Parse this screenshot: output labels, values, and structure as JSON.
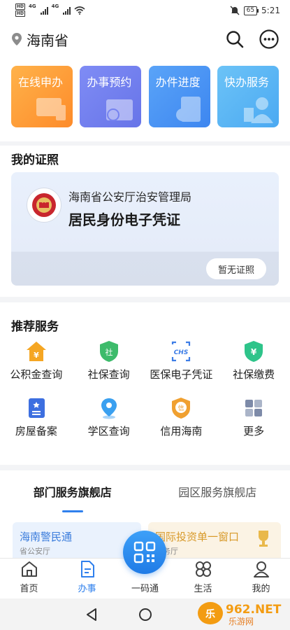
{
  "status_bar": {
    "sim1": "HD",
    "sim2": "HD",
    "net1": "4G",
    "net2": "4G",
    "battery": "65",
    "time": "5:21"
  },
  "header": {
    "province": "海南省"
  },
  "quick_tiles": [
    {
      "label": "在线申办"
    },
    {
      "label": "办事预约"
    },
    {
      "label": "办件进度"
    },
    {
      "label": "快办服务"
    }
  ],
  "licenses": {
    "title": "我的证照",
    "issuer": "海南省公安厅治安管理局",
    "name": "居民身份电子凭证",
    "button": "暂无证照"
  },
  "recommended": {
    "title": "推荐服务",
    "items": [
      {
        "label": "公积金查询",
        "icon": "house-yen-icon",
        "color": "#f5a623"
      },
      {
        "label": "社保查询",
        "icon": "shield-she-icon",
        "color": "#3dbb6b"
      },
      {
        "label": "医保电子凭证",
        "icon": "chs-icon",
        "color": "#3d7de6"
      },
      {
        "label": "社保缴费",
        "icon": "shield-yen-icon",
        "color": "#2ec48a"
      },
      {
        "label": "房屋备案",
        "icon": "book-star-icon",
        "color": "#3d6fe0"
      },
      {
        "label": "学区查询",
        "icon": "location-pin-icon",
        "color": "#3aa0f0"
      },
      {
        "label": "信用海南",
        "icon": "credit-badge-icon",
        "color": "#f0a030"
      },
      {
        "label": "更多",
        "icon": "grid-more-icon",
        "color": "#8a96b0"
      }
    ]
  },
  "flagship": {
    "tabs": [
      {
        "label": "部门服务旗舰店"
      },
      {
        "label": "园区服务旗舰店"
      }
    ],
    "banners": [
      {
        "title": "海南警民通",
        "sub": "省公安厅"
      },
      {
        "title": "国际投资单一窗口",
        "sub": "商务厅"
      }
    ]
  },
  "tabbar": [
    {
      "label": "首页"
    },
    {
      "label": "办事"
    },
    {
      "label": "一码通"
    },
    {
      "label": "生活"
    },
    {
      "label": "我的"
    }
  ],
  "watermark": {
    "brand": "962.NET",
    "sub": "乐游网"
  },
  "colors": {
    "accent": "#2f80ed"
  }
}
